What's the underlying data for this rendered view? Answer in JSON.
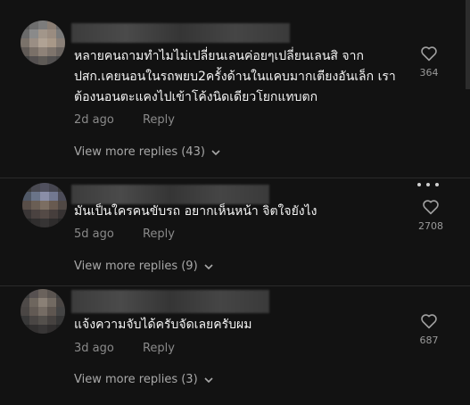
{
  "comments": [
    {
      "text": "หลายคนถามทำไมไม่เปลี่ยนเลนค่อยๆเปลี่ยนเลนสิ จาก ปสก.เคยนอนในรถพยบ2ครั้งด้านในแคบมากเตียงอันเล็ก เราต้องนอนตะแคงไปเข้าโค้งนิดเดียวโยกแทบตก",
      "time": "2d ago",
      "reply": "Reply",
      "likes": "364",
      "view_more": "View more replies (43)"
    },
    {
      "text": "มันเป็นใครคนขับรถ อยากเห็นหน้า จิตใจยังไง",
      "time": "5d ago",
      "reply": "Reply",
      "likes": "2708",
      "view_more": "View more replies (9)"
    },
    {
      "text": "แจ้งความจับได้ครับจัดเลยครับผม",
      "time": "3d ago",
      "reply": "Reply",
      "likes": "687",
      "view_more": "View more replies (3)"
    }
  ],
  "icons": {
    "like": "heart-outline-icon",
    "more": "more-options-icon",
    "expand": "chevron-down-icon"
  },
  "colors": {
    "background": "#121212",
    "text": "#f4f4f4",
    "muted": "#8a8a8a"
  }
}
